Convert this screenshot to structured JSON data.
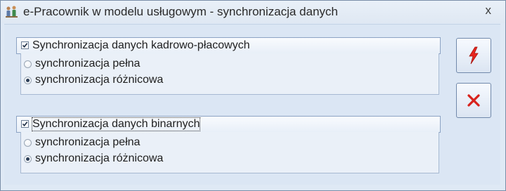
{
  "window": {
    "title": "e-Pracownik w modelu usługowym - synchronizacja danych",
    "close_glyph": "x"
  },
  "groups": [
    {
      "checkbox_label": "Synchronizacja danych kadrowo-płacowych",
      "checked": true,
      "options": [
        {
          "label": "synchronizacja pełna",
          "selected": false
        },
        {
          "label": "synchronizacja różnicowa",
          "selected": true
        }
      ]
    },
    {
      "checkbox_label": "Synchronizacja danych binarnych",
      "checked": true,
      "options": [
        {
          "label": "synchronizacja pełna",
          "selected": false
        },
        {
          "label": "synchronizacja różnicowa",
          "selected": true
        }
      ]
    }
  ],
  "buttons": {
    "run_icon": "lightning-icon",
    "cancel_icon": "close-icon"
  },
  "colors": {
    "lightning": "#e8261e",
    "cancel": "#d8221c"
  }
}
